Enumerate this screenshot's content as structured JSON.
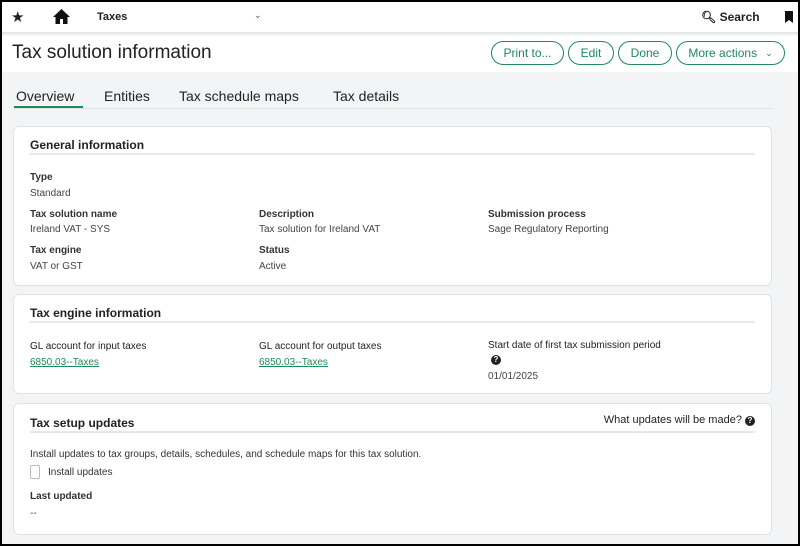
{
  "topbar": {
    "module": "Taxes",
    "search": "Search"
  },
  "header": {
    "title": "Tax solution information",
    "buttons": {
      "print": "Print to...",
      "edit": "Edit",
      "done": "Done",
      "more": "More actions"
    }
  },
  "tabs": [
    "Overview",
    "Entities",
    "Tax schedule maps",
    "Tax details"
  ],
  "general": {
    "heading": "General information",
    "type_label": "Type",
    "type_value": "Standard",
    "name_label": "Tax solution name",
    "name_value": "Ireland VAT - SYS",
    "desc_label": "Description",
    "desc_value": "Tax solution for Ireland VAT",
    "sub_label": "Submission process",
    "sub_value": "Sage Regulatory Reporting",
    "engine_label": "Tax engine",
    "engine_value": "VAT or GST",
    "status_label": "Status",
    "status_value": "Active"
  },
  "engine": {
    "heading": "Tax engine information",
    "input_label": "GL account for input taxes",
    "input_value": "6850.03--Taxes",
    "output_label": "GL account for output taxes",
    "output_value": "6850.03--Taxes",
    "start_label": "Start date of first tax submission period",
    "start_value": "01/01/2025"
  },
  "updates": {
    "heading": "Tax setup updates",
    "help_link": "What updates will be made?",
    "description": "Install updates to tax groups, details, schedules, and schedule maps for this tax solution.",
    "checkbox_label": "Install updates",
    "checkbox_checked": false,
    "last_label": "Last updated",
    "last_value": "--"
  },
  "colors": {
    "accent": "#1f8a5a",
    "background": "#f2f4f5"
  }
}
